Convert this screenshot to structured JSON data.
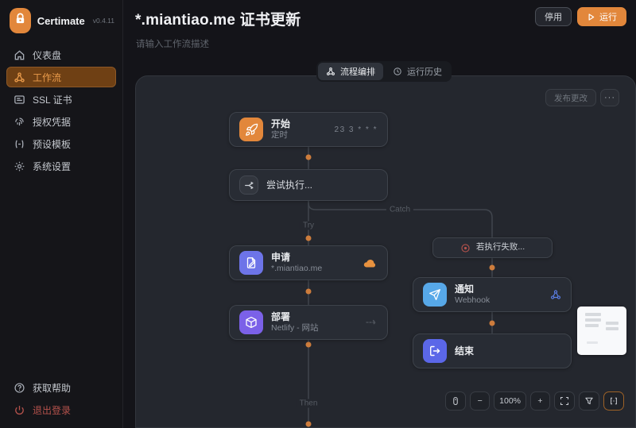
{
  "sidebar": {
    "brand": "Certimate",
    "version": "v0.4.11",
    "items": [
      {
        "label": "仪表盘"
      },
      {
        "label": "工作流"
      },
      {
        "label": "SSL 证书"
      },
      {
        "label": "授权凭据"
      },
      {
        "label": "预设模板"
      },
      {
        "label": "系统设置"
      }
    ],
    "help_label": "获取帮助",
    "logout_label": "退出登录"
  },
  "header": {
    "title": "*.miantiao.me 证书更新",
    "description_placeholder": "请输入工作流描述",
    "pause_label": "停用",
    "run_label": "运行"
  },
  "tabs": {
    "design": "流程编排",
    "history": "运行历史"
  },
  "canvas": {
    "publish_label": "发布更改",
    "more_label": "···",
    "labels": {
      "try": "Try",
      "catch": "Catch",
      "then": "Then"
    },
    "nodes": {
      "start": {
        "title": "开始",
        "subtitle": "定时",
        "meta": "23 3 * * *"
      },
      "tryblk": {
        "title": "尝试执行..."
      },
      "apply": {
        "title": "申请",
        "subtitle": "*.miantiao.me"
      },
      "deploy": {
        "title": "部署",
        "subtitle": "Netlify - 网站"
      },
      "onfail": {
        "title": "若执行失败..."
      },
      "notify": {
        "title": "通知",
        "subtitle": "Webhook"
      },
      "end": {
        "title": "结束"
      }
    },
    "toolbar": {
      "minus": "−",
      "zoom": "100%",
      "plus": "+"
    }
  },
  "colors": {
    "accent": "#e2873b",
    "node_apply": "#6d74e8",
    "node_deploy": "#7b61e8",
    "node_notify": "#57a8e8",
    "node_end": "#5b67e8",
    "danger": "#b5524c",
    "dot": "#cd7c3c"
  }
}
